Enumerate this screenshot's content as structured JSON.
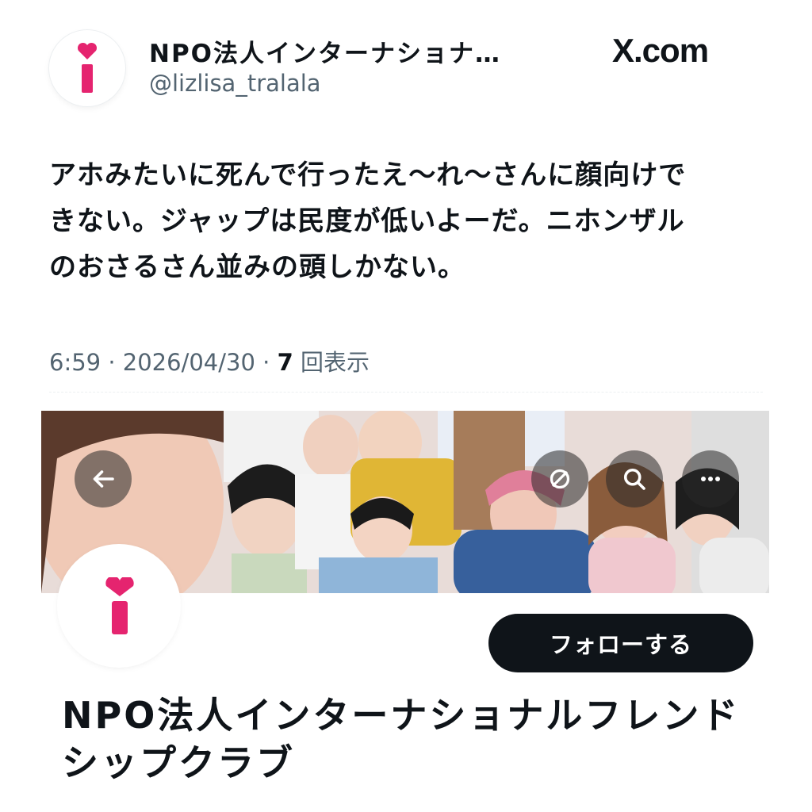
{
  "tweet": {
    "author_name": "NPO法人インターナショナ…",
    "author_handle": "@lizlisa_tralala",
    "source_label": "X.com",
    "text_line1": "アホみたいに死んで行ったえ〜れ〜さんに顔向けで",
    "text_line2": "きない。ジャップは民度が低いよーだ。ニホンザル",
    "text_line3": "のおさるさん並みの頭しかない。",
    "time": "6:59",
    "date": "2026/04/30",
    "views_count": "7",
    "views_label": "回表示"
  },
  "profile": {
    "follow_label": "フォローする",
    "name_line1": "NPO法人インターナショナルフレンド",
    "name_line2": "シップクラブ"
  },
  "icons": {
    "logo": "heart-i-logo",
    "back": "back-arrow-icon",
    "translate": "translate-icon",
    "search": "search-icon",
    "more": "more-icon"
  },
  "colors": {
    "logo_pink": "#e5246f",
    "button_dark": "#0f1419",
    "secondary_text": "#536471"
  }
}
